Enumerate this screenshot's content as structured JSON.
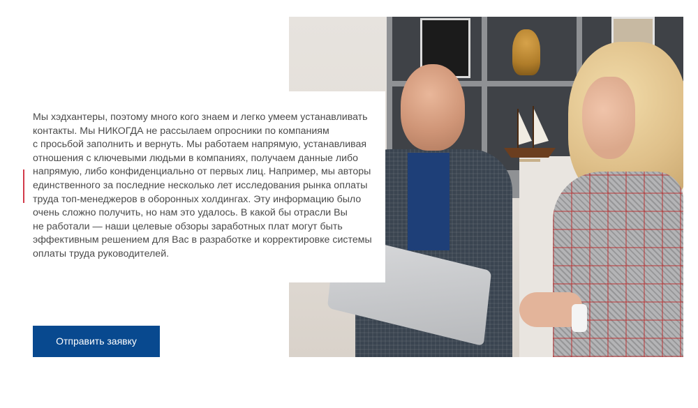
{
  "content": {
    "paragraph_lines": [
      "Мы хэдхантеры, поэтому много кого знаем и легко умеем устанавливать",
      "контакты. Мы НИКОГДА не рассылаем опросники по компаниям",
      "с просьбой заполнить и вернуть. Мы работаем напрямую, устанавливая",
      "отношения с ключевыми людьми в компаниях, получаем данные либо",
      "напрямую, либо конфиденциально от первых лиц. Например, мы авторы",
      "единственного за последние несколько лет исследования рынка оплаты",
      "труда топ-менеджеров в оборонных холдингах. Эту информацию было",
      "очень сложно получить, но нам это удалось. В какой бы отрасли Вы",
      "не работали — наши целевые обзоры заработных плат могут быть",
      "эффективным решением для Вас в разработке и корректировке системы",
      "оплаты труда руководителей."
    ]
  },
  "cta": {
    "label": "Отправить заявку"
  },
  "colors": {
    "button_bg": "#08498f",
    "accent_line": "#d23a4a",
    "text": "#4a4a4a"
  }
}
